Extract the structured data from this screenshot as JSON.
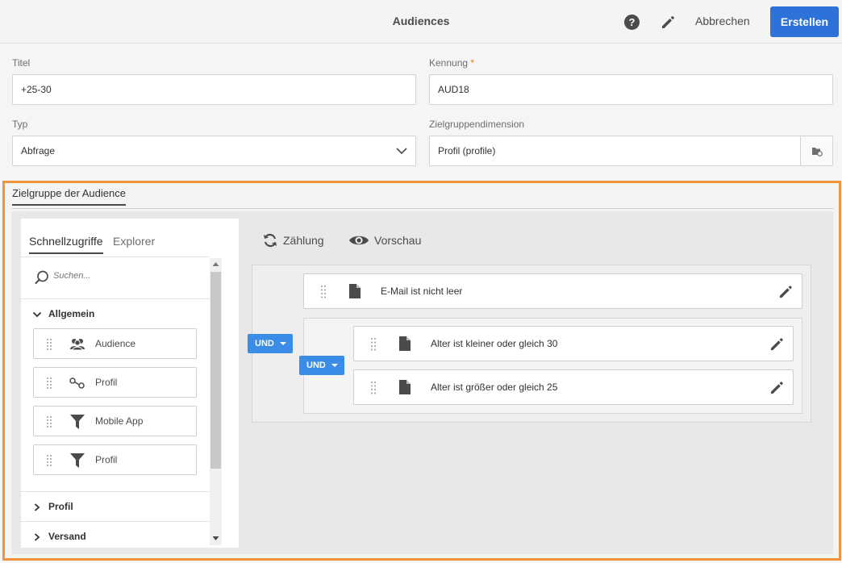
{
  "header": {
    "title": "Audiences",
    "help_label": "?",
    "cancel_label": "Abbrechen",
    "create_label": "Erstellen"
  },
  "form": {
    "title_label": "Titel",
    "title_value": "+25-30",
    "id_label": "Kennung",
    "id_required": "*",
    "id_value": "AUD18",
    "type_label": "Typ",
    "type_value": "Abfrage",
    "dimension_label": "Zielgruppendimension",
    "dimension_value": "Profil (profile)"
  },
  "section": {
    "tab_label": "Zielgruppe der Audience"
  },
  "palette": {
    "tabs": [
      "Schnellzugriffe",
      "Explorer"
    ],
    "search_placeholder": "Suchen...",
    "groups": [
      {
        "label": "Allgemein",
        "expanded": true
      },
      {
        "label": "Profil",
        "expanded": false
      },
      {
        "label": "Versand",
        "expanded": false
      }
    ],
    "items": [
      {
        "label": "Audience",
        "icon": "audience-icon"
      },
      {
        "label": "Profil",
        "icon": "relation-icon"
      },
      {
        "label": "Mobile App",
        "icon": "filter-icon"
      },
      {
        "label": "Profil",
        "icon": "filter-icon"
      }
    ]
  },
  "toolbar": {
    "count_label": "Zählung",
    "preview_label": "Vorschau"
  },
  "query": {
    "outer_operator": "UND",
    "inner_operator": "UND",
    "rules": [
      "E-Mail ist nicht leer",
      "Alter ist kleiner oder gleich 30",
      "Alter ist größer oder gleich 25"
    ]
  },
  "colors": {
    "accent": "#2d72d9",
    "operator": "#3b8ce6",
    "highlight": "#f0943c",
    "required": "#e68619"
  }
}
